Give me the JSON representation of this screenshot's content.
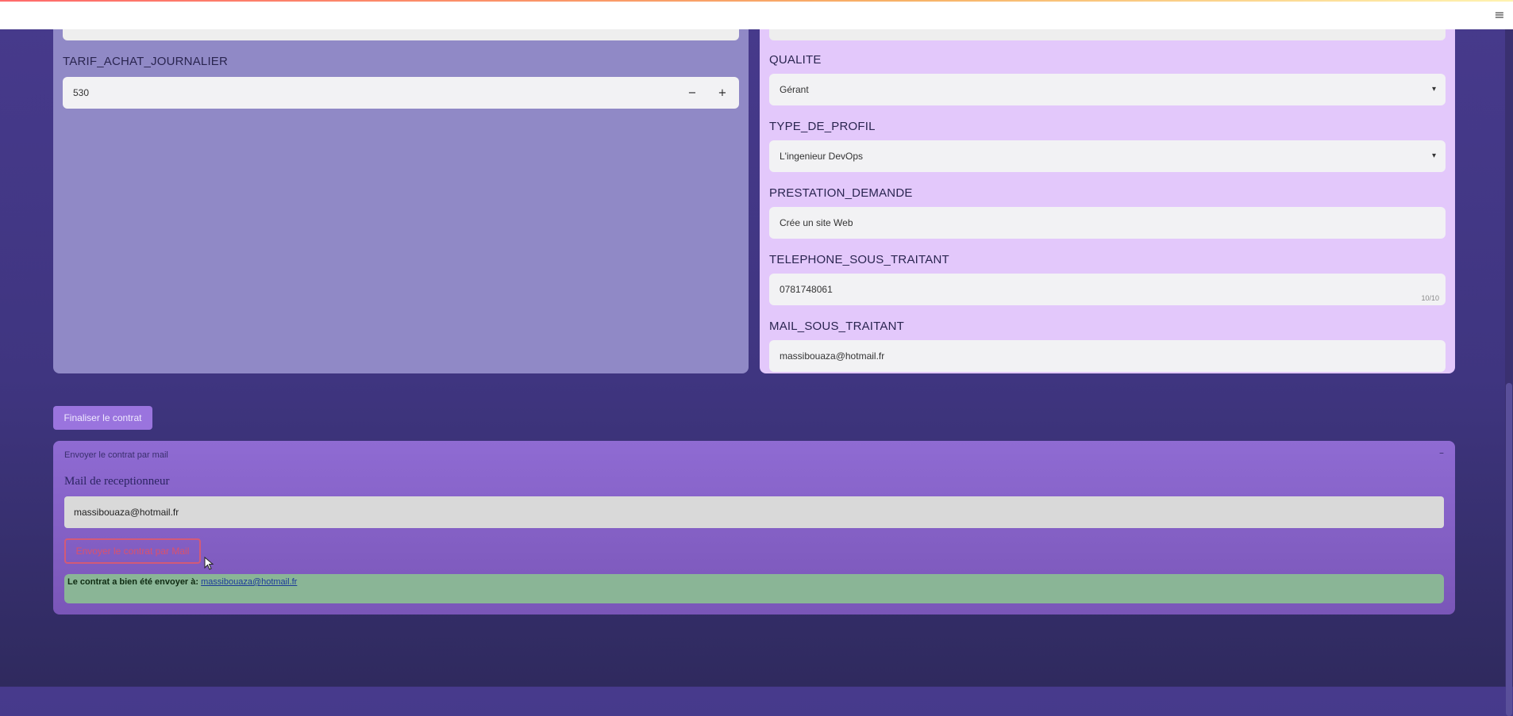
{
  "topbar": {
    "menu_icon": "hamburger-icon"
  },
  "left_panel": {
    "tarif_label": "TARIF_ACHAT_JOURNALIER",
    "tarif_value": "530",
    "minus": "−",
    "plus": "+"
  },
  "right_panel": {
    "qualite_label": "QUALITE",
    "qualite_value": "Gérant",
    "type_profil_label": "TYPE_DE_PROFIL",
    "type_profil_value": "L'ingenieur DevOps",
    "prestation_label": "PRESTATION_DEMANDE",
    "prestation_value": "Crée un site Web",
    "telephone_label": "TELEPHONE_SOUS_TRAITANT",
    "telephone_value": "0781748061",
    "telephone_counter": "10/10",
    "mail_label": "MAIL_SOUS_TRAITANT",
    "mail_value": "massibouaza@hotmail.fr"
  },
  "finalize_button": "Finaliser le contrat",
  "expander": {
    "header": "Envoyer le contrat par mail",
    "toggle": "–",
    "recipient_label": "Mail de receptionneur",
    "recipient_value": "massibouaza@hotmail.fr",
    "send_button": "Envoyer le contrat par Mail",
    "success_text": "Le contrat a bien été envoyer à: ",
    "success_link": "massibouaza@hotmail.fr"
  }
}
